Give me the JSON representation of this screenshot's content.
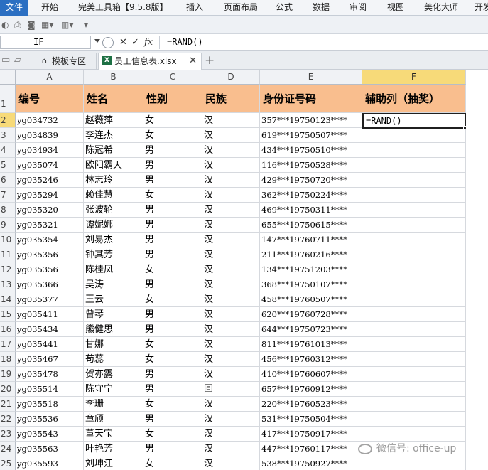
{
  "ribbon": {
    "tabs": [
      "文件",
      "开始",
      "完美工具箱【9.5.8版】",
      "插入",
      "页面布局",
      "公式",
      "数据",
      "审阅",
      "视图",
      "美化大师",
      "开发"
    ]
  },
  "formula_bar": {
    "name_box": "IF",
    "cancel": "✕",
    "enter": "✓",
    "fx": "fx",
    "formula": "=RAND()"
  },
  "doc_tabs": {
    "template_tab": "模板专区",
    "workbook_tab": "员工信息表.xlsx",
    "add": "+"
  },
  "sheet": {
    "columns": [
      "A",
      "B",
      "C",
      "D",
      "E",
      "F"
    ],
    "rows": [
      "1",
      "2",
      "3",
      "4",
      "5",
      "6",
      "7",
      "8",
      "9",
      "10",
      "11",
      "12",
      "13",
      "14",
      "15",
      "16",
      "17",
      "18",
      "19",
      "20",
      "21",
      "22",
      "23",
      "24",
      "25"
    ],
    "headers": [
      "编号",
      "姓名",
      "性别",
      "民族",
      "身份证号码",
      "辅助列（抽奖）"
    ],
    "data": [
      [
        "yg034732",
        "赵薇萍",
        "女",
        "汉",
        "357***19750123****"
      ],
      [
        "yg034839",
        "李连杰",
        "女",
        "汉",
        "619***19750507****"
      ],
      [
        "yg034934",
        "陈冠希",
        "男",
        "汉",
        "434***19750510****"
      ],
      [
        "yg035074",
        "欧阳霸天",
        "男",
        "汉",
        "116***19750528****"
      ],
      [
        "yg035246",
        "林志玲",
        "男",
        "汉",
        "429***19750720****"
      ],
      [
        "yg035294",
        "赖佳慧",
        "女",
        "汉",
        "362***19750224****"
      ],
      [
        "yg035320",
        "张波轮",
        "男",
        "汉",
        "469***19750311****"
      ],
      [
        "yg035321",
        "谭妮娜",
        "男",
        "汉",
        "655***19750615****"
      ],
      [
        "yg035354",
        "刘易杰",
        "男",
        "汉",
        "147***19760711****"
      ],
      [
        "yg035356",
        "钟其芳",
        "男",
        "汉",
        "211***19760216****"
      ],
      [
        "yg035356",
        "陈桂凤",
        "女",
        "汉",
        "134***19751203****"
      ],
      [
        "yg035366",
        "吴涛",
        "男",
        "汉",
        "368***19750107****"
      ],
      [
        "yg035377",
        "王云",
        "女",
        "汉",
        "458***19760507****"
      ],
      [
        "yg035411",
        "曾琴",
        "男",
        "汉",
        "620***19760728****"
      ],
      [
        "yg035434",
        "熊健思",
        "男",
        "汉",
        "644***19750723****"
      ],
      [
        "yg035441",
        "甘娜",
        "女",
        "汉",
        "811***19761013****"
      ],
      [
        "yg035467",
        "苟蕊",
        "女",
        "汉",
        "456***19760312****"
      ],
      [
        "yg035478",
        "贺亦露",
        "男",
        "汉",
        "410***19760607****"
      ],
      [
        "yg035514",
        "陈守宁",
        "男",
        "回",
        "657***19760912****"
      ],
      [
        "yg035518",
        "李珊",
        "女",
        "汉",
        "220***19760523****"
      ],
      [
        "yg035536",
        "章颀",
        "男",
        "汉",
        "531***19750504****"
      ],
      [
        "yg035543",
        "董天宝",
        "女",
        "汉",
        "417***19750917****"
      ],
      [
        "yg035563",
        "叶艳芳",
        "男",
        "汉",
        "447***19760117****"
      ],
      [
        "yg035593",
        "刘坤江",
        "女",
        "汉",
        "538***19750927****"
      ]
    ],
    "active_cell_value": "=RAND()"
  },
  "watermark": "微信号: office-up",
  "colors": {
    "header_fill": "#f9be8e",
    "selected_header": "#f7da79",
    "file_tab": "#2b6fc2"
  }
}
